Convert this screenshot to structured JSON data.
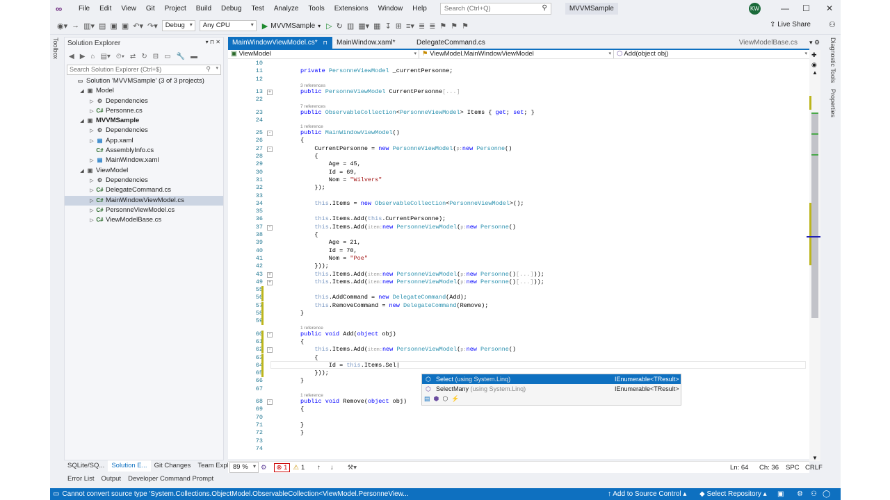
{
  "menubar": {
    "items": [
      "File",
      "Edit",
      "View",
      "Git",
      "Project",
      "Build",
      "Debug",
      "Test",
      "Analyze",
      "Tools",
      "Extensions",
      "Window",
      "Help"
    ],
    "search_placeholder": "Search (Ctrl+Q)",
    "app_name": "MVVMSample",
    "avatar": "KW"
  },
  "toolbar": {
    "config": "Debug",
    "platform": "Any CPU",
    "run_target": "MVVMSample",
    "live_share": "Live Share"
  },
  "left_rail": {
    "label": "Toolbox"
  },
  "right_rail": {
    "diagnostic": "Diagnostic Tools",
    "properties": "Properties"
  },
  "solution_explorer": {
    "title": "Solution Explorer",
    "search_placeholder": "Search Solution Explorer (Ctrl+$)",
    "items": [
      {
        "label": "Solution 'MVVMSample' (3 of 3 projects)",
        "depth": 0,
        "arrow": "",
        "icon": "▭",
        "bold": false
      },
      {
        "label": "Model",
        "depth": 1,
        "arrow": "◢",
        "icon": "▣",
        "bold": false
      },
      {
        "label": "Dependencies",
        "depth": 2,
        "arrow": "▷",
        "icon": "⚙",
        "bold": false
      },
      {
        "label": "Personne.cs",
        "depth": 2,
        "arrow": "▷",
        "icon": "C#",
        "bold": false
      },
      {
        "label": "MVVMSample",
        "depth": 1,
        "arrow": "◢",
        "icon": "▣",
        "bold": true
      },
      {
        "label": "Dependencies",
        "depth": 2,
        "arrow": "▷",
        "icon": "⚙",
        "bold": false
      },
      {
        "label": "App.xaml",
        "depth": 2,
        "arrow": "▷",
        "icon": "▤",
        "bold": false
      },
      {
        "label": "AssemblyInfo.cs",
        "depth": 2,
        "arrow": "",
        "icon": "C#",
        "bold": false
      },
      {
        "label": "MainWindow.xaml",
        "depth": 2,
        "arrow": "▷",
        "icon": "▤",
        "bold": false
      },
      {
        "label": "ViewModel",
        "depth": 1,
        "arrow": "◢",
        "icon": "▣",
        "bold": false
      },
      {
        "label": "Dependencies",
        "depth": 2,
        "arrow": "▷",
        "icon": "⚙",
        "bold": false
      },
      {
        "label": "DelegateCommand.cs",
        "depth": 2,
        "arrow": "▷",
        "icon": "C#",
        "bold": false
      },
      {
        "label": "MainWindowViewModel.cs",
        "depth": 2,
        "arrow": "▷",
        "icon": "C#",
        "bold": false,
        "selected": true
      },
      {
        "label": "PersonneViewModel.cs",
        "depth": 2,
        "arrow": "▷",
        "icon": "C#",
        "bold": false
      },
      {
        "label": "ViewModelBase.cs",
        "depth": 2,
        "arrow": "▷",
        "icon": "C#",
        "bold": false
      }
    ]
  },
  "bottom_tabs": [
    "SQLite/SQ...",
    "Solution E...",
    "Git Changes",
    "Team Expl..."
  ],
  "output_tabs": [
    "Error List",
    "Output",
    "Developer Command Prompt"
  ],
  "doc_tabs": {
    "active": "MainWindowViewModel.cs*",
    "tab2": "MainWindow.xaml*",
    "tab3": "DelegateCommand.cs",
    "right": "ViewModelBase.cs"
  },
  "navbar": {
    "project": "ViewModel",
    "class": "ViewModel.MainWindowViewModel",
    "member": "Add(object obj)"
  },
  "code_lines": [
    {
      "n": "10",
      "ref": "",
      "html": ""
    },
    {
      "n": "11",
      "ref": "",
      "html": "<span class='kw'>private</span> <span class='ty'>PersonneViewModel</span> _currentPersonne;"
    },
    {
      "n": "12",
      "ref": "",
      "html": ""
    },
    {
      "n": "13",
      "ref": "3 references",
      "html": "<span class='kw'>public</span> <span class='ty'>PersonneViewModel</span> CurrentPersonne<span class='ghost'>[...]</span>",
      "fold": "+"
    },
    {
      "n": "22",
      "ref": "",
      "html": ""
    },
    {
      "n": "23",
      "ref": "7 references",
      "html": "<span class='kw'>public</span> <span class='ty'>ObservableCollection</span>&lt;<span class='ty'>PersonneViewModel</span>&gt; Items { <span class='kw'>get</span>; <span class='kw'>set</span>; }"
    },
    {
      "n": "24",
      "ref": "",
      "html": ""
    },
    {
      "n": "25",
      "ref": "1 reference",
      "html": "<span class='kw'>public</span> <span class='ty'>MainWindowViewModel</span>()",
      "fold": "-"
    },
    {
      "n": "26",
      "ref": "",
      "html": "{"
    },
    {
      "n": "27",
      "ref": "",
      "html": "    CurrentPersonne = <span class='kw'>new</span> <span class='ty'>PersonneViewModel</span>(<span class='hint'>p:</span><span class='kw'>new</span> <span class='ty'>Personne</span>()",
      "fold": "-"
    },
    {
      "n": "28",
      "ref": "",
      "html": "    {"
    },
    {
      "n": "29",
      "ref": "",
      "html": "        Age = 45,"
    },
    {
      "n": "30",
      "ref": "",
      "html": "        Id = 69,"
    },
    {
      "n": "31",
      "ref": "",
      "html": "        Nom = <span class='str'>\"Wilvers\"</span>"
    },
    {
      "n": "32",
      "ref": "",
      "html": "    });"
    },
    {
      "n": "33",
      "ref": "",
      "html": ""
    },
    {
      "n": "34",
      "ref": "",
      "html": "    <span class='thisk'>this</span>.Items = <span class='kw'>new</span> <span class='ty'>ObservableCollection</span>&lt;<span class='ty'>PersonneViewModel</span>&gt;();"
    },
    {
      "n": "35",
      "ref": "",
      "html": ""
    },
    {
      "n": "36",
      "ref": "",
      "html": "    <span class='thisk'>this</span>.Items.Add(<span class='thisk'>this</span>.CurrentPersonne);"
    },
    {
      "n": "37",
      "ref": "",
      "html": "    <span class='thisk'>this</span>.Items.Add(<span class='hint'>item:</span><span class='kw'>new</span> <span class='ty'>PersonneViewModel</span>(<span class='hint'>p:</span><span class='kw'>new</span> <span class='ty'>Personne</span>()",
      "fold": "-"
    },
    {
      "n": "38",
      "ref": "",
      "html": "    {"
    },
    {
      "n": "39",
      "ref": "",
      "html": "        Age = 21,"
    },
    {
      "n": "40",
      "ref": "",
      "html": "        Id = 70,"
    },
    {
      "n": "41",
      "ref": "",
      "html": "        Nom = <span class='str'>\"Poe\"</span>"
    },
    {
      "n": "42",
      "ref": "",
      "html": "    }));"
    },
    {
      "n": "43",
      "ref": "",
      "html": "    <span class='thisk'>this</span>.Items.Add(<span class='hint'>item:</span><span class='kw'>new</span> <span class='ty'>PersonneViewModel</span>(<span class='hint'>p:</span><span class='kw'>new</span> <span class='ty'>Personne</span>()<span class='ghost'>[...]</span>));",
      "fold": "+"
    },
    {
      "n": "49",
      "ref": "",
      "html": "    <span class='thisk'>this</span>.Items.Add(<span class='hint'>item:</span><span class='kw'>new</span> <span class='ty'>PersonneViewModel</span>(<span class='hint'>p:</span><span class='kw'>new</span> <span class='ty'>Personne</span>()<span class='ghost'>[...]</span>));",
      "fold": "+"
    },
    {
      "n": "55",
      "ref": "",
      "html": ""
    },
    {
      "n": "56",
      "ref": "",
      "html": "    <span class='thisk'>this</span>.AddCommand = <span class='kw'>new</span> <span class='ty'>DelegateCommand</span>(Add);"
    },
    {
      "n": "57",
      "ref": "",
      "html": "    <span class='thisk'>this</span>.RemoveCommand = <span class='kw'>new</span> <span class='ty'>DelegateCommand</span>(Remove);"
    },
    {
      "n": "58",
      "ref": "",
      "html": "}"
    },
    {
      "n": "59",
      "ref": "",
      "html": ""
    },
    {
      "n": "60",
      "ref": "1 reference",
      "html": "<span class='kw'>public</span> <span class='kw'>void</span> Add(<span class='kw'>object</span> obj)",
      "fold": "-"
    },
    {
      "n": "61",
      "ref": "",
      "html": "{"
    },
    {
      "n": "62",
      "ref": "",
      "html": "    <span class='thisk'>this</span>.Items.Add(<span class='hint'>item:</span><span class='kw'>new</span> <span class='ty'>PersonneViewModel</span>(<span class='hint'>p:</span><span class='kw'>new</span> <span class='ty'>Personne</span>()",
      "fold": "-"
    },
    {
      "n": "63",
      "ref": "",
      "html": "    {"
    },
    {
      "n": "64",
      "ref": "",
      "html": "        Id = <span class='thisk'>this</span>.Items.Sel|"
    },
    {
      "n": "65",
      "ref": "",
      "html": "    }));"
    },
    {
      "n": "66",
      "ref": "",
      "html": "}"
    },
    {
      "n": "67",
      "ref": "",
      "html": ""
    },
    {
      "n": "68",
      "ref": "1 reference",
      "html": "<span class='kw'>public</span> <span class='kw'>void</span> Remove(<span class='kw'>object</span> obj)",
      "fold": "-"
    },
    {
      "n": "69",
      "ref": "",
      "html": "{"
    },
    {
      "n": "70",
      "ref": "",
      "html": ""
    },
    {
      "n": "71",
      "ref": "",
      "html": "}"
    },
    {
      "n": "72",
      "ref": "",
      "html": "}"
    },
    {
      "n": "73",
      "ref": "",
      "html": ""
    },
    {
      "n": "74",
      "ref": "",
      "html": ""
    }
  ],
  "completion": {
    "items": [
      {
        "label": "Select",
        "ghost": "(using System.Linq)",
        "type": "IEnumerable<TResult>"
      },
      {
        "label": "SelectMany",
        "ghost": "(using System.Linq)",
        "type": "IEnumerable<TResult>"
      }
    ]
  },
  "editor_status": {
    "zoom": "89 %",
    "errors": "1",
    "warnings": "1",
    "ln": "Ln: 64",
    "ch": "Ch: 36",
    "spc": "SPC",
    "crlf": "CRLF"
  },
  "statusbar": {
    "message": "Cannot convert source type 'System.Collections.ObjectModel.ObservableCollection<ViewModel.PersonneView...",
    "source_control": "Add to Source Control",
    "repo": "Select Repository"
  }
}
